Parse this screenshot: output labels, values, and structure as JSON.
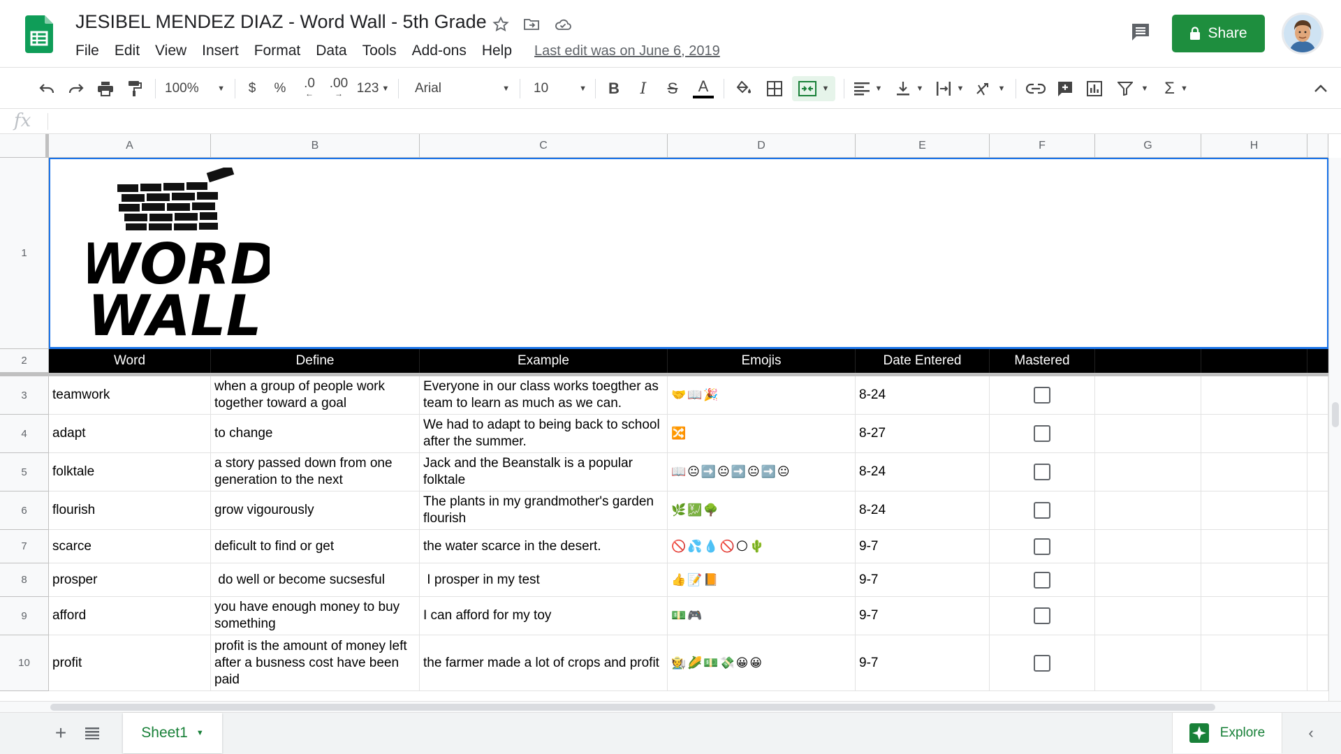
{
  "app": {
    "doc_title": "JESIBEL MENDEZ DIAZ - Word Wall - 5th Grade",
    "menu": [
      "File",
      "Edit",
      "View",
      "Insert",
      "Format",
      "Data",
      "Tools",
      "Add-ons",
      "Help"
    ],
    "last_edit": "Last edit was on June 6, 2019",
    "share_label": "Share",
    "brand_color": "#1e8e3e"
  },
  "toolbar": {
    "zoom": "100%",
    "currency": "$",
    "percent": "%",
    "dec_decrease": ".0",
    "dec_increase": ".00",
    "more_formats": "123",
    "font": "Arial",
    "font_size": "10"
  },
  "formula_bar": {
    "fx": "fx",
    "value": ""
  },
  "columns": [
    "A",
    "B",
    "C",
    "D",
    "E",
    "F",
    "G",
    "H"
  ],
  "banner": {
    "line1": "WORD",
    "line2": "WALL"
  },
  "headers": [
    "Word",
    "Define",
    "Example",
    "Emojis",
    "Date Entered",
    "Mastered"
  ],
  "rows": [
    {
      "num": "1"
    },
    {
      "num": "2"
    },
    {
      "num": "3",
      "word": "teamwork",
      "define": "when a group of people work together toward a goal",
      "example": "Everyone in our class works toegther as team to learn as much as we can.",
      "emojis": "🤝📖🎉",
      "date": "8-24",
      "mastered": false
    },
    {
      "num": "4",
      "word": "adapt",
      "define": "to change",
      "example": "We had to adapt to being back to school after the summer.",
      "emojis": "🔀",
      "date": "8-27",
      "mastered": false
    },
    {
      "num": "5",
      "word": "folktale",
      "define": "a story passed down from one generation to the next",
      "example": "Jack and the Beanstalk is a popular folktale",
      "emojis": "📖😐➡️😐➡️😐➡️😐",
      "date": "8-24",
      "mastered": false
    },
    {
      "num": "6",
      "word": "flourish",
      "define": "grow vigourously",
      "example": "The plants in my grandmother's garden flourish",
      "emojis": "🌿💹🌳",
      "date": "8-24",
      "mastered": false
    },
    {
      "num": "7",
      "word": "scarce",
      "define": "deficult to find or get",
      "example": "the water scarce in the desert.",
      "emojis": "🚫💦💧🚫🌕🌵",
      "date": "9-7",
      "mastered": false
    },
    {
      "num": "8",
      "word": "prosper",
      "define": " do well or become sucsesful",
      "example": " I prosper in my test",
      "emojis": "👍📝📙",
      "date": "9-7",
      "mastered": false
    },
    {
      "num": "9",
      "word": "afford",
      "define": "you have enough money to buy something",
      "example": "I can afford for my toy",
      "emojis": "💵🎮",
      "date": "9-7",
      "mastered": false
    },
    {
      "num": "10",
      "word": "profit",
      "define": "profit is the amount of money left after a busness cost have been paid",
      "example": "the farmer made a lot of crops and profit",
      "emojis": "🧑‍🌾🌽💵💸😀😀",
      "date": "9-7",
      "mastered": false
    }
  ],
  "sheets": [
    {
      "name": "Sheet1"
    }
  ],
  "explore_label": "Explore"
}
